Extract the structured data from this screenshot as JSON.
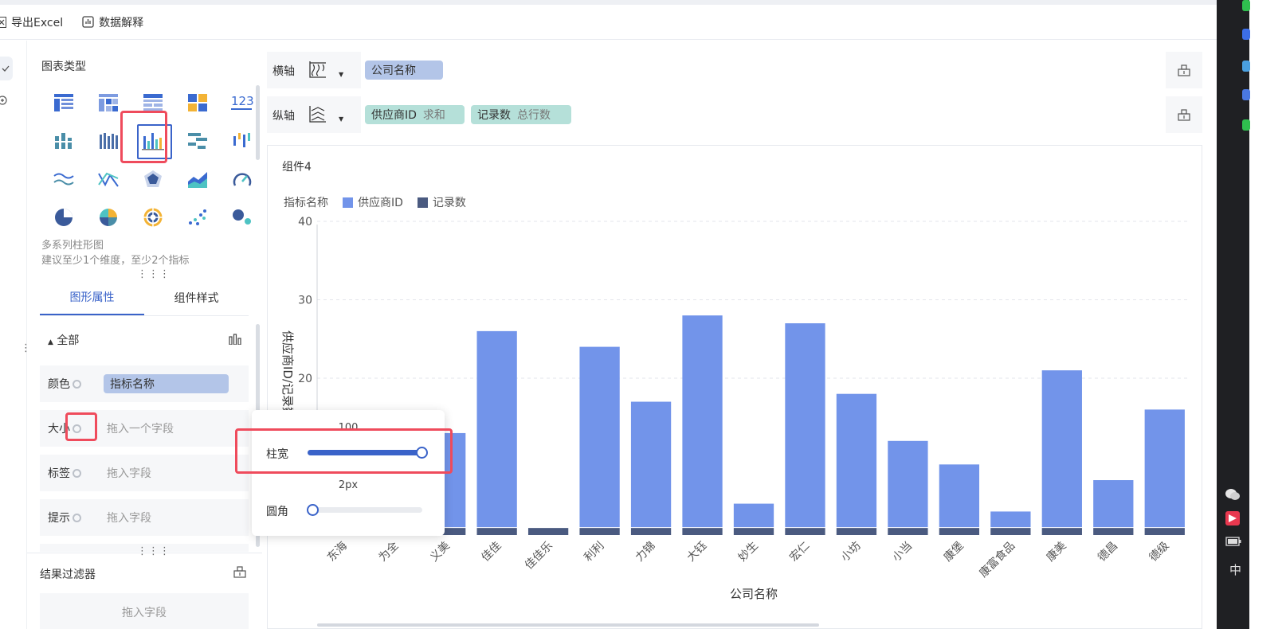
{
  "toolbar": {
    "export_label": "导出Excel",
    "explain_label": "数据解释"
  },
  "panel": {
    "chart_types_title": "图表类型",
    "chart_type_123": "123",
    "selected_name": "多系列柱形图",
    "selected_hint": "建议至少1个维度，至少2个指标",
    "tabs": [
      "图形属性",
      "组件样式"
    ],
    "section_all": "全部",
    "props": [
      {
        "label": "颜色",
        "value": "指标名称",
        "is_pill": true
      },
      {
        "label": "大小",
        "value": "拖入一个字段",
        "is_pill": false
      },
      {
        "label": "标签",
        "value": "拖入字段",
        "is_pill": false
      },
      {
        "label": "提示",
        "value": "拖入字段",
        "is_pill": false
      }
    ],
    "filter_title": "结果过滤器",
    "filter_hint": "拖入字段"
  },
  "axes": {
    "x_label": "横轴",
    "x_field": "公司名称",
    "y_label": "纵轴",
    "y_fields": [
      {
        "name": "供应商ID",
        "agg": "求和"
      },
      {
        "name": "记录数",
        "agg": "总行数"
      }
    ]
  },
  "component_title": "组件4",
  "popup": {
    "width_label": "柱宽",
    "width_value": "100",
    "width_fraction": 1.0,
    "radius_label": "圆角",
    "radius_value": "2px",
    "radius_fraction": 0.0
  },
  "system": {
    "ime": "中"
  },
  "chart_data": {
    "type": "bar",
    "legend_title": "指标名称",
    "xlabel": "公司名称",
    "ylabel": "供应商ID/记录数",
    "ylim": [
      0,
      40
    ],
    "yticks": [
      20,
      30,
      40
    ],
    "categories": [
      "东海",
      "为全",
      "义美",
      "佳佳",
      "佳佳乐",
      "利利",
      "力锦",
      "大钰",
      "妙生",
      "宏仁",
      "小坊",
      "小当",
      "康堡",
      "康富食品",
      "康美",
      "德昌",
      "德级"
    ],
    "series": [
      {
        "name": "供应商ID",
        "color": "#7294ea",
        "values": [
          0,
          0,
          12,
          25,
          0,
          23,
          16,
          27,
          3,
          26,
          17,
          11,
          8,
          2,
          20,
          6,
          15
        ]
      },
      {
        "name": "记录数",
        "color": "#4a5a80",
        "values": [
          1,
          1,
          1,
          1,
          1,
          1,
          1,
          1,
          1,
          1,
          1,
          1,
          1,
          1,
          1,
          1,
          1
        ]
      }
    ]
  }
}
